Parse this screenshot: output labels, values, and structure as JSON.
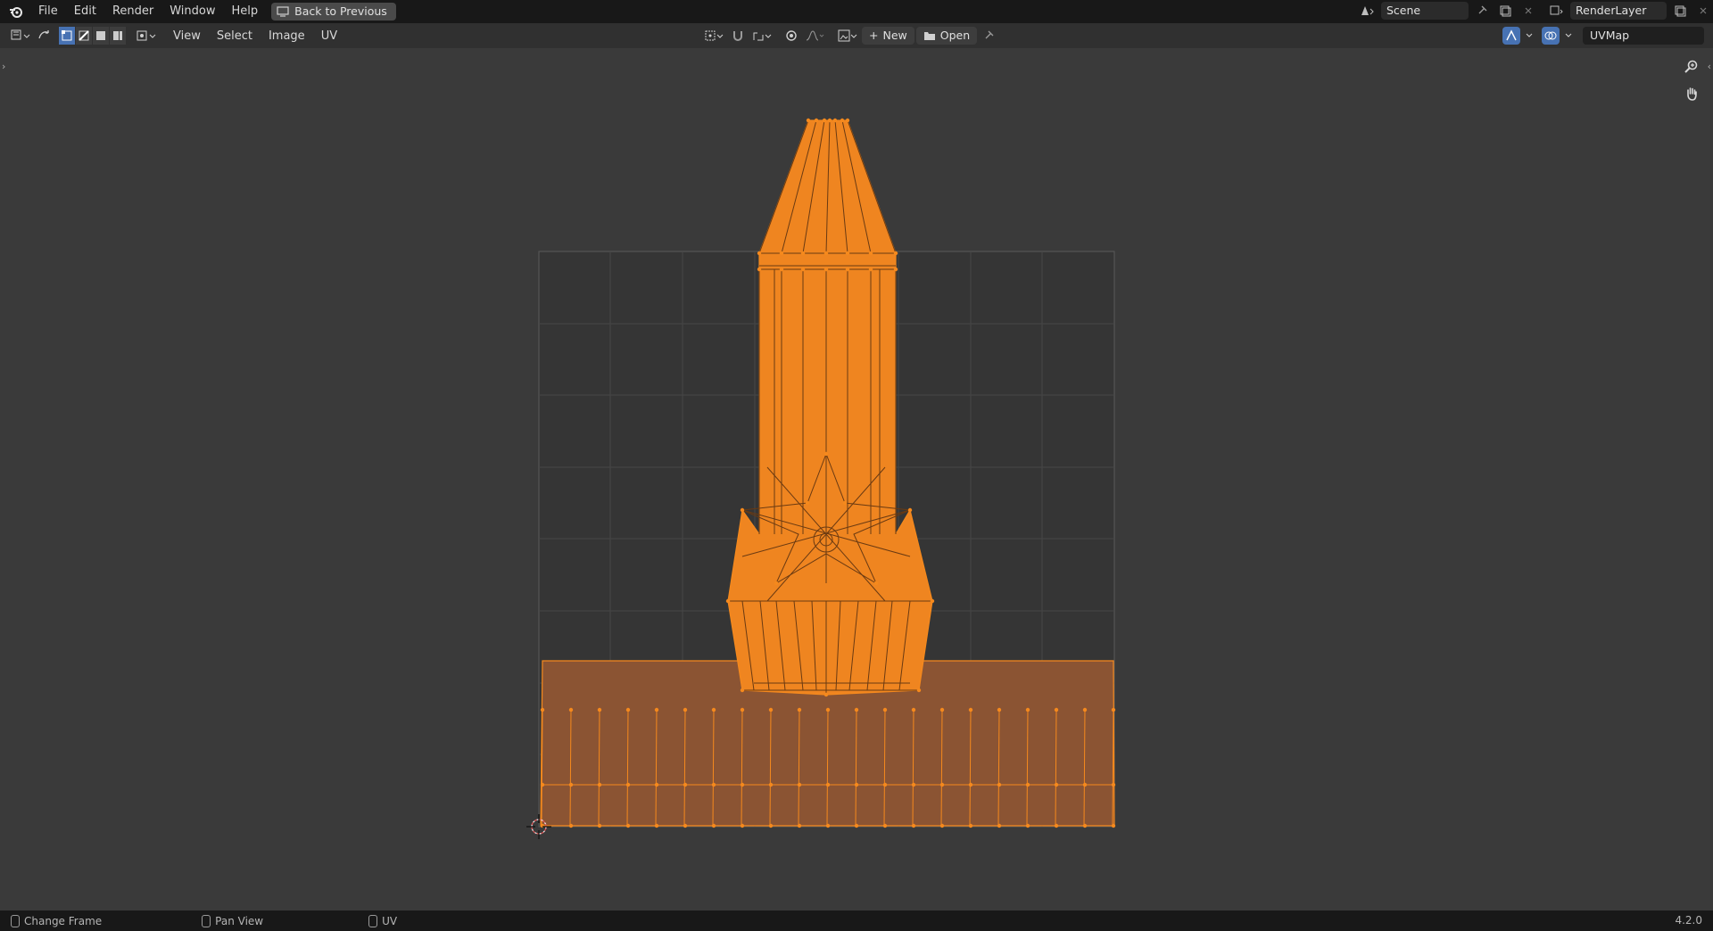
{
  "menu": [
    "File",
    "Edit",
    "Render",
    "Window",
    "Help"
  ],
  "back_button": "Back to Previous",
  "scene": {
    "label": "Scene"
  },
  "render_layer": {
    "label": "RenderLayer"
  },
  "editor_menu": [
    "View",
    "Select",
    "Image",
    "UV"
  ],
  "image_buttons": {
    "new_label": "New",
    "open_label": "Open"
  },
  "uv_map": {
    "value": "UVMap"
  },
  "status": {
    "left": "Change Frame",
    "middle": "Pan View",
    "right": "UV",
    "version": "4.2.0"
  },
  "colors": {
    "accent": "#4772b3",
    "selection_orange": "#f5891d",
    "mesh_fill_light": "#ef8520",
    "mesh_fill_dark": "#8b5433",
    "grid_line": "#4a4a4a",
    "background": "#3a3a3a"
  },
  "icons": {
    "blender": "blender-logo-icon",
    "back": "screen-icon",
    "zoom": "zoom-icon",
    "pan": "hand-icon",
    "cursor": "2d-cursor-icon"
  }
}
